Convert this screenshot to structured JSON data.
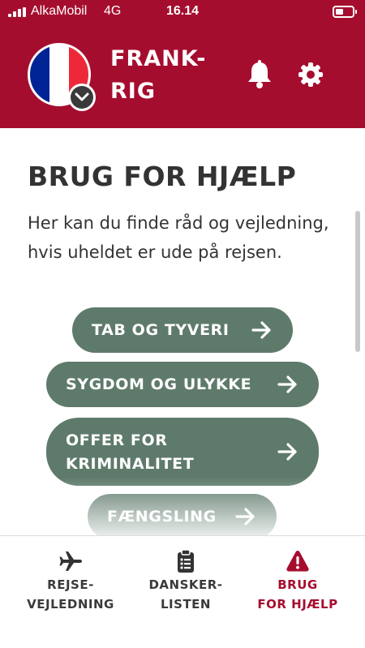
{
  "status_bar": {
    "carrier": "AlkaMobil",
    "network": "4G",
    "time": "16.14"
  },
  "header": {
    "country_title": "FRANK-\nRIG",
    "flag_icon": "france-flag-icon",
    "actions": [
      "bell-icon",
      "gear-icon"
    ]
  },
  "main": {
    "title": "BRUG FOR HJÆLP",
    "intro": "Her kan du finde råd og vejledning, hvis uheldet er ude på rejsen.",
    "buttons": [
      {
        "label": "TAB OG TYVERI",
        "icon": "arrow-right-icon"
      },
      {
        "label": "SYGDOM OG ULYKKE",
        "icon": "arrow-right-icon"
      },
      {
        "label": "OFFER FOR\nKRIMINALITET",
        "icon": "arrow-right-icon"
      },
      {
        "label": "FÆNGSLING",
        "icon": "arrow-right-icon"
      }
    ]
  },
  "bottom_nav": {
    "items": [
      {
        "label": "REJSE-\nVEJLEDNING",
        "icon": "airplane-icon",
        "active": false
      },
      {
        "label": "DANSKER-\nLISTEN",
        "icon": "clipboard-icon",
        "active": false
      },
      {
        "label": "BRUG\nFOR HJÆLP",
        "icon": "warning-icon",
        "active": true
      }
    ]
  },
  "colors": {
    "brand_red": "#a50d2e",
    "button_green": "#5e7a6b",
    "text_dark": "#333333"
  }
}
